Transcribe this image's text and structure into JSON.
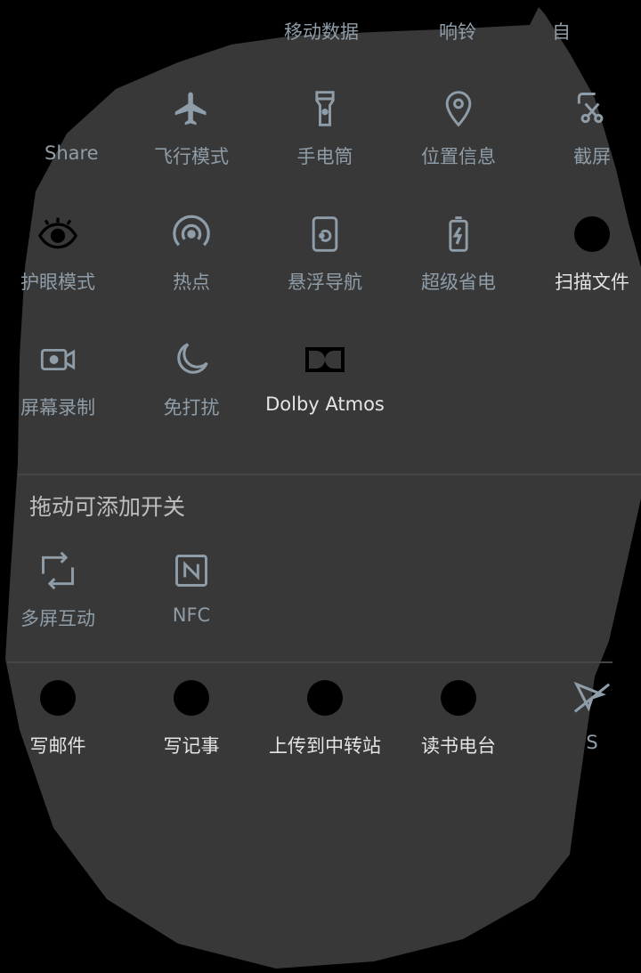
{
  "top_labels": [
    "移动数据",
    "响铃",
    "自"
  ],
  "active_tiles": [
    {
      "label": "Share",
      "icon": "share-icon"
    },
    {
      "label": "飞行模式",
      "icon": "airplane-icon"
    },
    {
      "label": "手电筒",
      "icon": "flashlight-icon"
    },
    {
      "label": "位置信息",
      "icon": "location-icon"
    },
    {
      "label": "截屏",
      "icon": "screenshot-icon"
    },
    {
      "label": "护眼模式",
      "icon": "eye-icon"
    },
    {
      "label": "热点",
      "icon": "hotspot-icon"
    },
    {
      "label": "悬浮导航",
      "icon": "floating-nav-icon"
    },
    {
      "label": "超级省电",
      "icon": "battery-saver-icon"
    },
    {
      "label": "扫描文件",
      "icon": "scan-file-icon"
    },
    {
      "label": "屏幕录制",
      "icon": "screen-record-icon"
    },
    {
      "label": "免打扰",
      "icon": "moon-icon"
    },
    {
      "label": "Dolby Atmos",
      "icon": "dolby-icon"
    }
  ],
  "add_section": {
    "title": "拖动可添加开关",
    "tiles": [
      {
        "label": "多屏互动",
        "icon": "multiscreen-icon"
      },
      {
        "label": "NFC",
        "icon": "nfc-icon"
      }
    ]
  },
  "shortcut_tiles": [
    {
      "label": "写邮件",
      "icon": "compose-mail-icon"
    },
    {
      "label": "写记事",
      "icon": "compose-note-icon"
    },
    {
      "label": "上传到中转站",
      "icon": "upload-relay-icon"
    },
    {
      "label": "读书电台",
      "icon": "reading-radio-icon"
    },
    {
      "label": "S",
      "icon": "sync-off-icon"
    }
  ],
  "colors": {
    "background": "#000000",
    "panel": "#383838",
    "icon": "#8f9da8",
    "divider": "#454545"
  }
}
